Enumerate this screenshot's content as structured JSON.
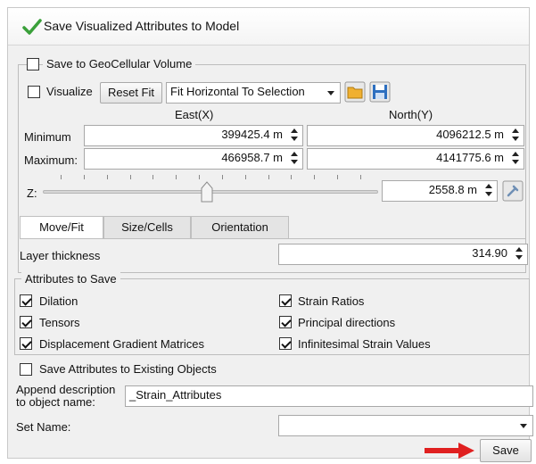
{
  "dialog": {
    "title": "Save Visualized Attributes to Model"
  },
  "geocellular": {
    "checkbox_label": "Save to GeoCellular Volume",
    "visualize_label": "Visualize",
    "reset_fit_label": "Reset Fit",
    "fit_select_value": "Fit Horizontal To Selection",
    "col_east": "East(X)",
    "col_north": "North(Y)",
    "row_min_label": "Minimum",
    "row_max_label": "Maximum:",
    "min_east": "399425.4 m",
    "min_north": "4096212.5 m",
    "max_east": "466958.7 m",
    "max_north": "4141775.6 m",
    "z_label": "Z:",
    "z_value": "2558.8 m",
    "z_slider_fraction": 0.49
  },
  "tabs": [
    {
      "label": "Move/Fit",
      "active": true
    },
    {
      "label": "Size/Cells",
      "active": false
    },
    {
      "label": "Orientation",
      "active": false
    }
  ],
  "layer": {
    "label": "Layer thickness",
    "value": "314.90"
  },
  "attributes": {
    "legend": "Attributes to Save",
    "items": [
      {
        "label": "Dilation",
        "checked": true
      },
      {
        "label": "Strain Ratios",
        "checked": true
      },
      {
        "label": "Tensors",
        "checked": true
      },
      {
        "label": "Principal directions",
        "checked": true
      },
      {
        "label": "Displacement Gradient Matrices",
        "checked": true
      },
      {
        "label": "Infinitesimal Strain Values",
        "checked": true
      }
    ]
  },
  "existing": {
    "label": "Save Attributes to Existing Objects",
    "checked": false
  },
  "append": {
    "label_line1": "Append description",
    "label_line2": "to object name:",
    "value": "_Strain_Attributes"
  },
  "set_name": {
    "label": "Set Name:",
    "value": ""
  },
  "save_button": {
    "label": "Save"
  },
  "colors": {
    "arrow": "#e02020",
    "check": "#3aa03a",
    "save_icon": "#2d6fc0",
    "folder_icon": "#f0b030"
  }
}
